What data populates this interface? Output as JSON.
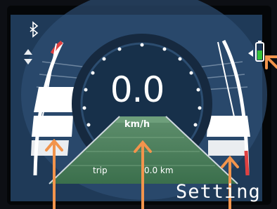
{
  "status": {
    "bluetooth_icon": "bluetooth-icon",
    "mode_icon": "up-down-arrows-icon",
    "battery_icon": "battery-icon",
    "battery_color": "#35c43a"
  },
  "speed": {
    "value": "0.0",
    "unit": "km/h"
  },
  "trip": {
    "label": "trip",
    "value": "0.0 km"
  },
  "menu": {
    "setting_label": "Setting"
  },
  "annotations": {
    "arrow_color": "#f2944c"
  }
}
